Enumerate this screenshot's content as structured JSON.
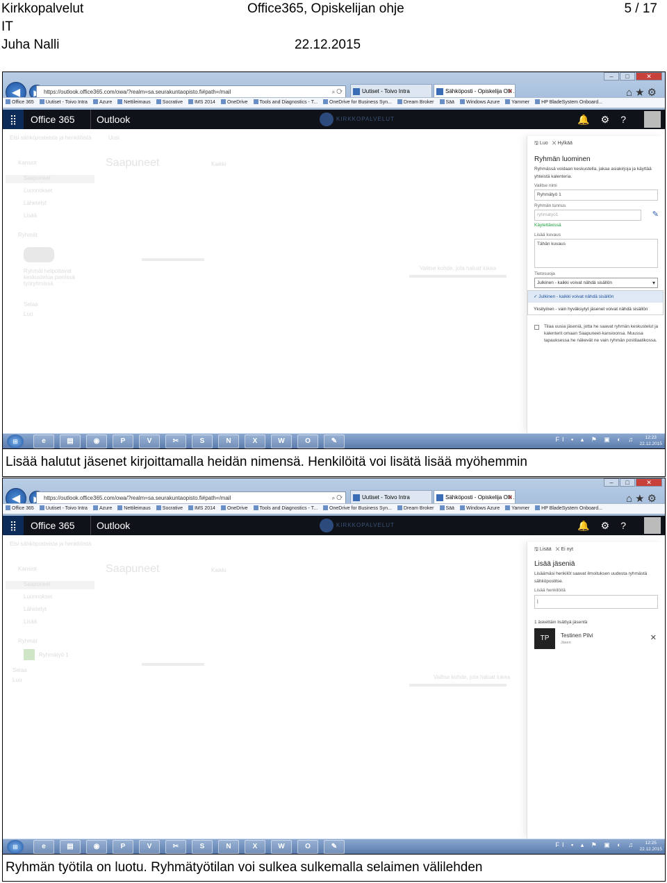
{
  "header": {
    "org_line1": "Kirkkopalvelut",
    "org_line2": "IT",
    "author": "Juha Nalli",
    "doc_title": "Office365, Opiskelijan ohje",
    "date": "22.12.2015",
    "page": "5 / 17"
  },
  "captions": {
    "figure1": "Lisää halutut jäsenet kirjoittamalla heidän nimensä. Henkilöitä voi lisätä lisää myöhemmin",
    "figure2": "Ryhmän työtila on luotu. Ryhmätyötilan voi sulkea sulkemalla selaimen välilehden"
  },
  "browser": {
    "url": "https://outlook.office365.com/owa/?realm=sa.seurakuntaopisto.fi#path=/mail",
    "tabs": [
      {
        "label": "Uutiset - Toivo Intra"
      },
      {
        "label": "Sähköposti - Opiskelija Olli ..."
      }
    ],
    "favorites": [
      "Office 365",
      "Uutiset - Toivo Intra",
      "Azure",
      "Nettileimaus",
      "Socrative",
      "IMS 2014",
      "OneDrive",
      "Tools and Diagnostics - T...",
      "OneDrive for Business Syn...",
      "Dream Broker",
      "Sää",
      "Windows Azure",
      "Yammer",
      "HP BladeSystem Onboard..."
    ]
  },
  "suite": {
    "app_name": "Office 365",
    "module": "Outlook",
    "logo_text": "KIRKKOPALVELUT"
  },
  "owa_background": {
    "search_placeholder": "Etsi sähköposteista ja henkilöistä",
    "new_label": "Uusi",
    "folders_header": "Kansiot",
    "inbox": "Saapuneet",
    "folder_items": [
      "Saapuneet",
      "Luonnokset",
      "Lähetetyt",
      "Lisää"
    ],
    "groups_header": "Ryhmät",
    "groups_note": "Ryhmät helpottavat keskustelua pienissä työryhmissä",
    "groups_actions": [
      "Selaa",
      "Luo"
    ],
    "filter": "Kaikki",
    "list_empty": "Ei näytettäviä kohteita",
    "reading_text": "Valitse kohde, jota haluat lukea"
  },
  "figure1_panel": {
    "save": "Luo",
    "cancel": "Hylkää",
    "title": "Ryhmän luominen",
    "description": "Ryhmässä voidaan keskustella, jakaa asiakirjoja ja käyttää yhteistä kalenteria.",
    "name_label": "Valitse nimi",
    "name_value": "Ryhmätyö 1",
    "id_label": "Ryhmän tunnus",
    "id_value": "ryhmatyo1",
    "available": "Käytettävissä",
    "desc_label": "Lisää kuvaus",
    "desc_placeholder": "Tähän kuvaus",
    "privacy_label": "Tietosuoja",
    "privacy_value": "Julkinen - kaikki voivat nähdä sisällön",
    "privacy_options": [
      "Julkinen - kaikki voivat nähdä sisällön",
      "Yksityinen - vain hyväksytyt jäsenet voivat nähdä sisällön"
    ],
    "subscribe_text": "Tilaa uusia jäseniä, jotta he saavat ryhmän keskustelut ja kalenterit omaan Saapuneet-kansioonsa. Muussa tapauksessa he näkevät ne vain ryhmän postilaatikossa."
  },
  "figure2_panel": {
    "add": "Lisää",
    "not_now": "Ei nyt",
    "title": "Lisää jäseniä",
    "description": "Lisäämäsi henkilöt saavat ilmoituksen uudesta ryhmästä sähköpostitse.",
    "people_label": "Lisää henkilöitä",
    "recent_label": "1 äskettäin lisättyä jäsentä",
    "member_initials": "TP",
    "member_name": "Testinen Pilvi",
    "member_role": "Jäsen",
    "group_name": "Ryhmätyö 1"
  },
  "taskbar": {
    "start": "⊞",
    "apps": [
      "e",
      "▤",
      "◉",
      "P",
      "V",
      "✂",
      "S",
      "N",
      "X",
      "W",
      "O",
      "✎"
    ],
    "tray": "FI ▪ ▴ ⚑ ▣ ◐ ♫",
    "fig1_time": "12:23",
    "fig2_time": "12:25",
    "date": "22.12.2015"
  }
}
